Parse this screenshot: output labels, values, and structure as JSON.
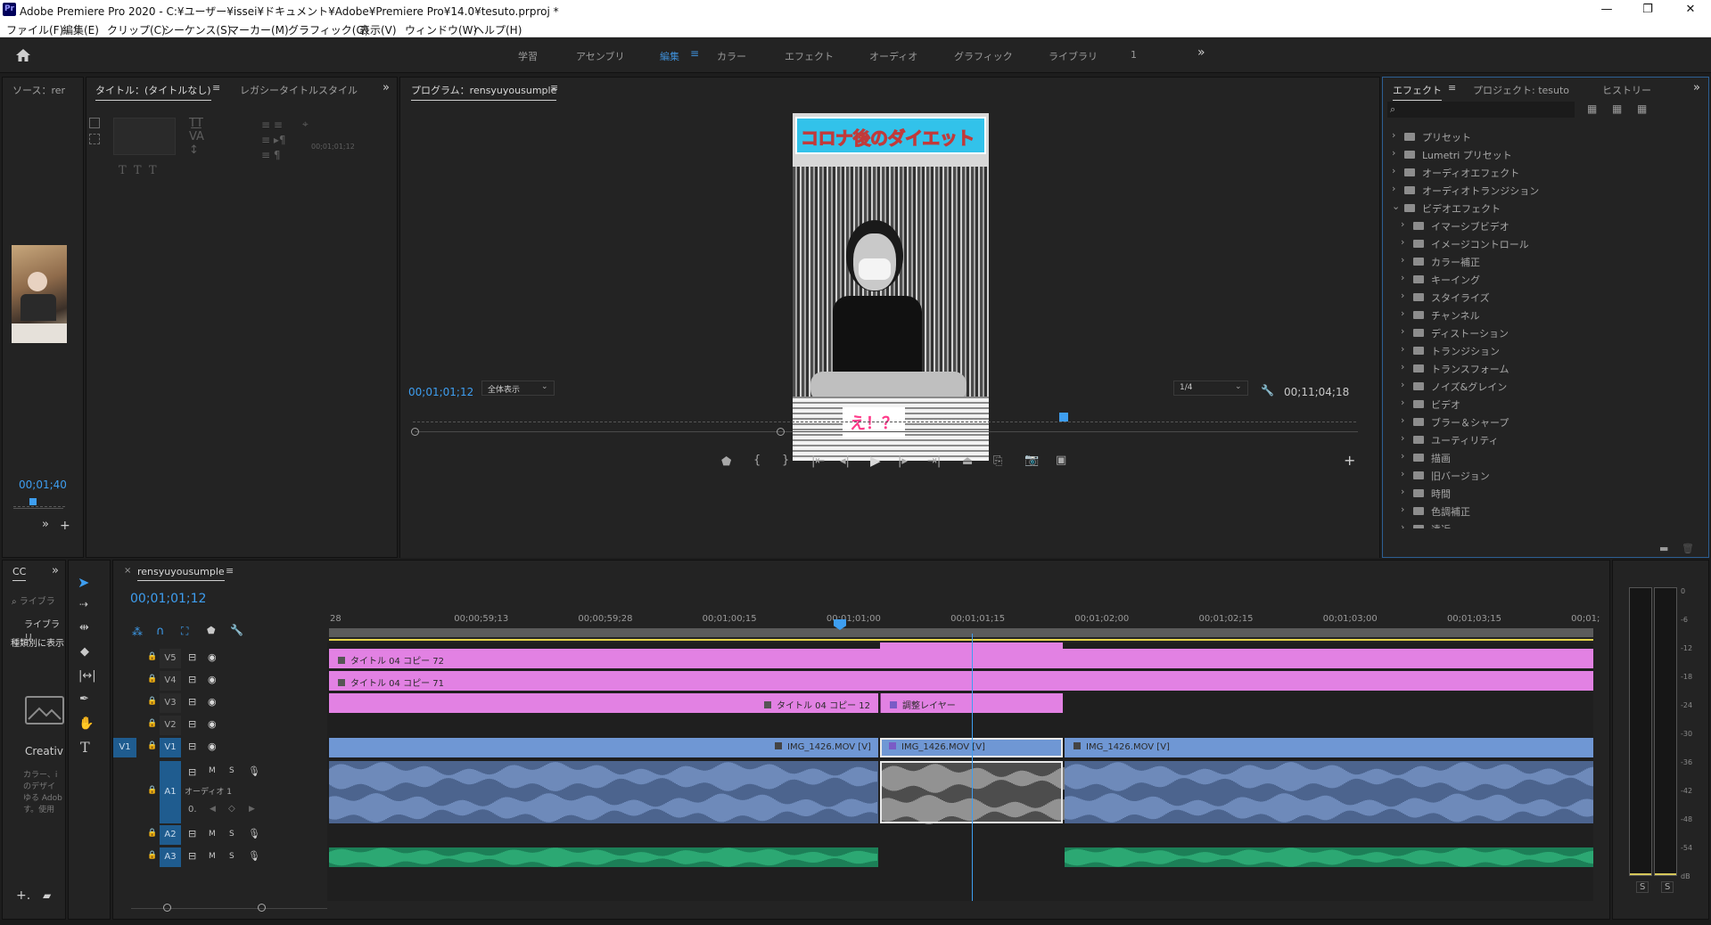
{
  "window": {
    "title": "Adobe Premiere Pro 2020 - C:¥ユーザー¥issei¥ドキュメント¥Adobe¥Premiere Pro¥14.0¥tesuto.prproj *",
    "app_badge": "Pr",
    "controls": [
      "—",
      "❐",
      "✕"
    ]
  },
  "menu": [
    "ファイル(F)",
    "編集(E)",
    "クリップ(C)",
    "シーケンス(S)",
    "マーカー(M)",
    "グラフィック(G)",
    "表示(V)",
    "ウィンドウ(W)",
    "ヘルプ(H)"
  ],
  "workspaces": {
    "items": [
      "学習",
      "アセンブリ",
      "編集",
      "カラー",
      "エフェクト",
      "オーディオ",
      "グラフィック",
      "ライブラリ",
      "1"
    ],
    "active": "編集",
    "more": "»"
  },
  "source_panel": {
    "tab": "ソース：rer",
    "timecode": "00;01;40"
  },
  "title_panel": {
    "tabs": [
      "タイトル：(タイトルなし)",
      "レガシータイトルスタイル"
    ],
    "field_timecode": "00;01;01;12"
  },
  "program_panel": {
    "tab": "プログラム：rensyuyousumple",
    "timecode_left": "00;01;01;12",
    "zoom": "全体表示",
    "resolution": "1/4",
    "timecode_right": "00;11;04;18",
    "frame_caption": "コロナ後のダイエット",
    "frame_subtitle": "え！？",
    "playhead_fraction": 0.685
  },
  "effects_panel": {
    "tabs": [
      "エフェクト",
      "プロジェクト: tesuto",
      "ヒストリー"
    ],
    "tree": [
      {
        "label": "プリセット",
        "level": 0,
        "expanded": false
      },
      {
        "label": "Lumetri プリセット",
        "level": 0,
        "expanded": false
      },
      {
        "label": "オーディオエフェクト",
        "level": 0,
        "expanded": false
      },
      {
        "label": "オーディオトランジション",
        "level": 0,
        "expanded": false
      },
      {
        "label": "ビデオエフェクト",
        "level": 0,
        "expanded": true
      },
      {
        "label": "イマーシブビデオ",
        "level": 1,
        "expanded": false
      },
      {
        "label": "イメージコントロール",
        "level": 1,
        "expanded": false
      },
      {
        "label": "カラー補正",
        "level": 1,
        "expanded": false
      },
      {
        "label": "キーイング",
        "level": 1,
        "expanded": false
      },
      {
        "label": "スタイライズ",
        "level": 1,
        "expanded": false
      },
      {
        "label": "チャンネル",
        "level": 1,
        "expanded": false
      },
      {
        "label": "ディストーション",
        "level": 1,
        "expanded": false
      },
      {
        "label": "トランジション",
        "level": 1,
        "expanded": false
      },
      {
        "label": "トランスフォーム",
        "level": 1,
        "expanded": false
      },
      {
        "label": "ノイズ&グレイン",
        "level": 1,
        "expanded": false
      },
      {
        "label": "ビデオ",
        "level": 1,
        "expanded": false
      },
      {
        "label": "ブラー＆シャープ",
        "level": 1,
        "expanded": false
      },
      {
        "label": "ユーティリティ",
        "level": 1,
        "expanded": false
      },
      {
        "label": "描画",
        "level": 1,
        "expanded": false
      },
      {
        "label": "旧バージョン",
        "level": 1,
        "expanded": false
      },
      {
        "label": "時間",
        "level": 1,
        "expanded": false
      },
      {
        "label": "色調補正",
        "level": 1,
        "expanded": false
      },
      {
        "label": "遠近",
        "level": 1,
        "expanded": false
      }
    ]
  },
  "libraries_panel": {
    "tab": "CC",
    "search_placeholder": "ライブラ",
    "dropdown": "ライブラリ",
    "view_label": "種類別に表示",
    "creative": "Creativ",
    "blurb": [
      "カラー、i",
      "のデザイ",
      "ゆる Adob",
      "す。使用"
    ]
  },
  "timeline": {
    "tab": "rensyuyousumple",
    "timecode": "00;01;01;12",
    "ruler": [
      "28",
      "00;00;59;13",
      "00;00;59;28",
      "00;01;00;15",
      "00;01;01;00",
      "00;01;01;15",
      "00;01;02;00",
      "00;01;02;15",
      "00;01;03;00",
      "00;01;03;15",
      "00;01;"
    ],
    "tracks": {
      "video": [
        "V5",
        "V4",
        "V3",
        "V2",
        "V1"
      ],
      "audio": [
        "A1",
        "A2",
        "A3"
      ],
      "source_patch_video": "V1",
      "audio_name": "オーディオ 1",
      "audio_volume": "0.",
      "mute": "M",
      "solo": "S"
    },
    "clips": {
      "v5": "タイトル 04 コピー 72",
      "v4": "タイトル 04 コピー 71",
      "v3a": "タイトル 04 コピー 12",
      "v3b": "調整レイヤー",
      "v1a": "IMG_1426.MOV [V]",
      "v1b": "IMG_1426.MOV [V]",
      "v1c": "IMG_1426.MOV [V]"
    },
    "colors": {
      "title_clip": "#e281e3",
      "video_clip": "#6f97d4",
      "audio_clip": "#5f7fb3",
      "audio3_clip": "#2ea873",
      "playhead": "#3e9ef0"
    }
  },
  "meter": {
    "scale": [
      "0",
      "-6",
      "-12",
      "-18",
      "-24",
      "-30",
      "-36",
      "-42",
      "-48",
      "-54",
      "dB"
    ],
    "solo_buttons": [
      "S",
      "S"
    ]
  },
  "icons": [
    "home-icon",
    "menu-icon",
    "search-icon",
    "folder-icon",
    "wrench-icon",
    "play-icon",
    "camera-icon",
    "plus-icon",
    "lock-icon",
    "eye-icon",
    "mic-icon",
    "selection-tool-icon",
    "pen-tool-icon",
    "hand-tool-icon",
    "type-tool-icon"
  ]
}
